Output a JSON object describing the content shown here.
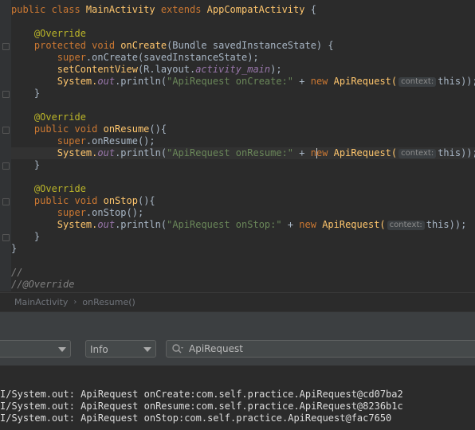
{
  "editor": {
    "lines": {
      "l1": {
        "kw1": "public class ",
        "cls": "MainActivity",
        "kw2": " extends ",
        "base": "AppCompatActivity",
        "rest": " {"
      },
      "l3": {
        "ann": "@Override"
      },
      "l4": {
        "kw": "protected void ",
        "meth": "onCreate",
        "rest": "(Bundle savedInstanceState) {"
      },
      "l5": {
        "kw": "super",
        "rest": ".onCreate(savedInstanceState);"
      },
      "l6": {
        "meth": "setContentView",
        "p1": "(R.layout.",
        "field": "activity_main",
        "p2": ");"
      },
      "l7": {
        "cls": "System.",
        "field": "out",
        "p1": ".println(",
        "str": "\"ApiRequest onCreate:\"",
        "p2": " + ",
        "kw": "new ",
        "cls2": "ApiRequest(",
        "hint": "context:",
        "p3": "this));"
      },
      "l8": {
        "rest": "}"
      },
      "l10": {
        "ann": "@Override"
      },
      "l11": {
        "kw": "public void ",
        "meth": "onResume",
        "rest": "(){"
      },
      "l12": {
        "kw": "super",
        "rest": ".onResume();"
      },
      "l13": {
        "cls": "System.",
        "field": "out",
        "p1": ".println(",
        "str": "\"ApiRequest onResume:\"",
        "p2": " + ",
        "kwa": "n",
        "kwb": "ew ",
        "cls2": "ApiRequest(",
        "hint": "context:",
        "p3": "this));"
      },
      "l14": {
        "rest": "}"
      },
      "l16": {
        "ann": "@Override"
      },
      "l17": {
        "kw": "public void ",
        "meth": "onStop",
        "rest": "(){"
      },
      "l18": {
        "kw": "super",
        "rest": ".onStop();"
      },
      "l19": {
        "cls": "System.",
        "field": "out",
        "p1": ".println(",
        "str": "\"ApiRequest onStop:\"",
        "p2": " + ",
        "kw": "new ",
        "cls2": "ApiRequest(",
        "hint": "context:",
        "p3": "this));"
      },
      "l20": {
        "rest": "    }"
      },
      "l21": {
        "rest": "}"
      },
      "l23": {
        "cmt": "//"
      },
      "l24": {
        "cmt": "//@Override"
      }
    }
  },
  "breadcrumb": {
    "items": [
      "MainActivity",
      "onResume()"
    ],
    "separator": "›"
  },
  "logcat": {
    "level_select": "Info",
    "search_value": "ApiRequest",
    "lines": [
      "I/System.out: ApiRequest onCreate:com.self.practice.ApiRequest@cd07ba2",
      "I/System.out: ApiRequest onResume:com.self.practice.ApiRequest@8236b1c",
      "I/System.out: ApiRequest onStop:com.self.practice.ApiRequest@fac7650"
    ]
  },
  "colors": {
    "keyword": "#cc7832",
    "annotation": "#bbb529",
    "string": "#6a8759",
    "field": "#9876aa",
    "method": "#ffc66d",
    "background": "#2b2b2b",
    "panel": "#3c3f41"
  }
}
